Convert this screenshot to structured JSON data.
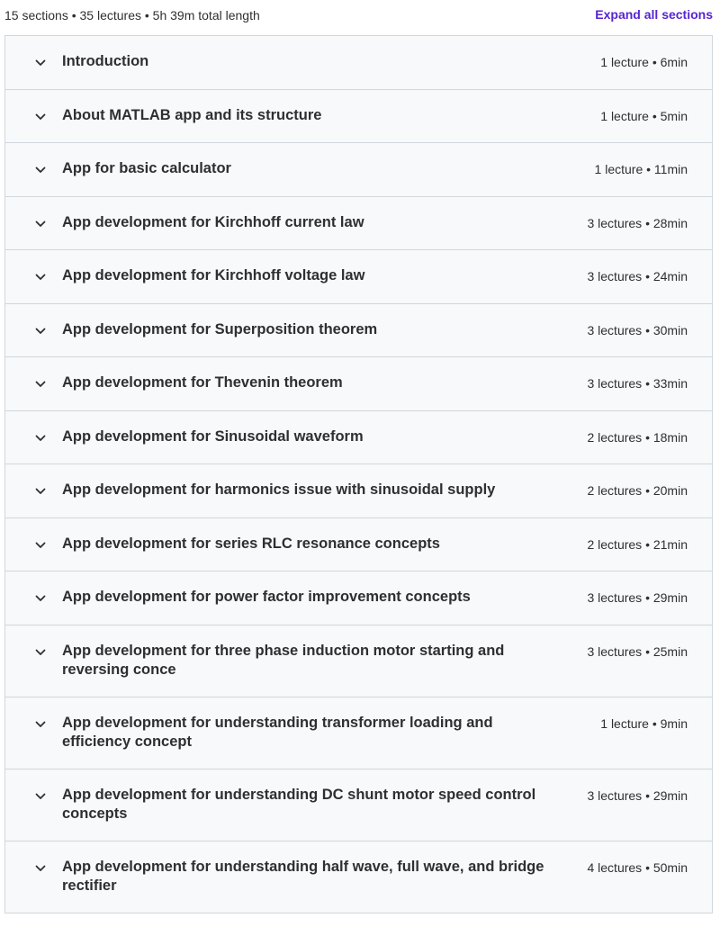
{
  "summary": {
    "text": "15 sections • 35 lectures • 5h 39m total length",
    "expand_label": "Expand all sections"
  },
  "colors": {
    "accent": "#5624d0",
    "section_bg": "#f7f9fa",
    "border": "#d1d7dc",
    "text": "#2d2f31"
  },
  "sections": [
    {
      "title": "Introduction",
      "meta": "1 lecture • 6min"
    },
    {
      "title": "About MATLAB app and its structure",
      "meta": "1 lecture • 5min"
    },
    {
      "title": "App for basic calculator",
      "meta": "1 lecture • 11min"
    },
    {
      "title": "App development for Kirchhoff current law",
      "meta": "3 lectures • 28min"
    },
    {
      "title": "App development for Kirchhoff voltage law",
      "meta": "3 lectures • 24min"
    },
    {
      "title": "App development for Superposition theorem",
      "meta": "3 lectures • 30min"
    },
    {
      "title": "App development for Thevenin theorem",
      "meta": "3 lectures • 33min"
    },
    {
      "title": "App development for Sinusoidal waveform",
      "meta": "2 lectures • 18min"
    },
    {
      "title": "App development for harmonics issue with sinusoidal supply",
      "meta": "2 lectures • 20min"
    },
    {
      "title": "App development for series RLC resonance concepts",
      "meta": "2 lectures • 21min"
    },
    {
      "title": "App development for power factor improvement concepts",
      "meta": "3 lectures • 29min"
    },
    {
      "title": "App development for three phase induction motor starting and reversing conce",
      "meta": "3 lectures • 25min"
    },
    {
      "title": "App development for understanding transformer loading and efficiency concept",
      "meta": "1 lecture • 9min"
    },
    {
      "title": "App development for understanding DC shunt motor speed control concepts",
      "meta": "3 lectures • 29min"
    },
    {
      "title": "App development for understanding half wave, full wave, and bridge rectifier",
      "meta": "4 lectures • 50min"
    }
  ]
}
